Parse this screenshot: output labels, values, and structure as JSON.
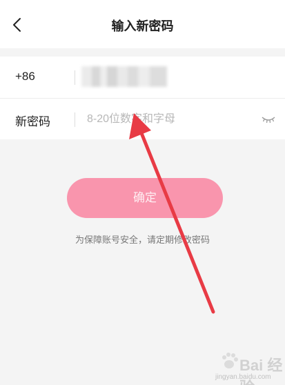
{
  "header": {
    "title": "输入新密码"
  },
  "form": {
    "phone": {
      "label": "+86"
    },
    "password": {
      "label": "新密码",
      "placeholder": "8-20位数字和字母"
    }
  },
  "confirm_label": "确定",
  "hint": "为保障账号安全，请定期修改密码",
  "watermark": {
    "text": "Bai 经验",
    "sub": "jingyan.baidu.com"
  },
  "colors": {
    "button": "#f995ad",
    "arrow": "#e83b45",
    "background": "#f4f4f4"
  },
  "icons": {
    "back": "chevron-left-icon",
    "eye": "eye-closed-icon"
  }
}
